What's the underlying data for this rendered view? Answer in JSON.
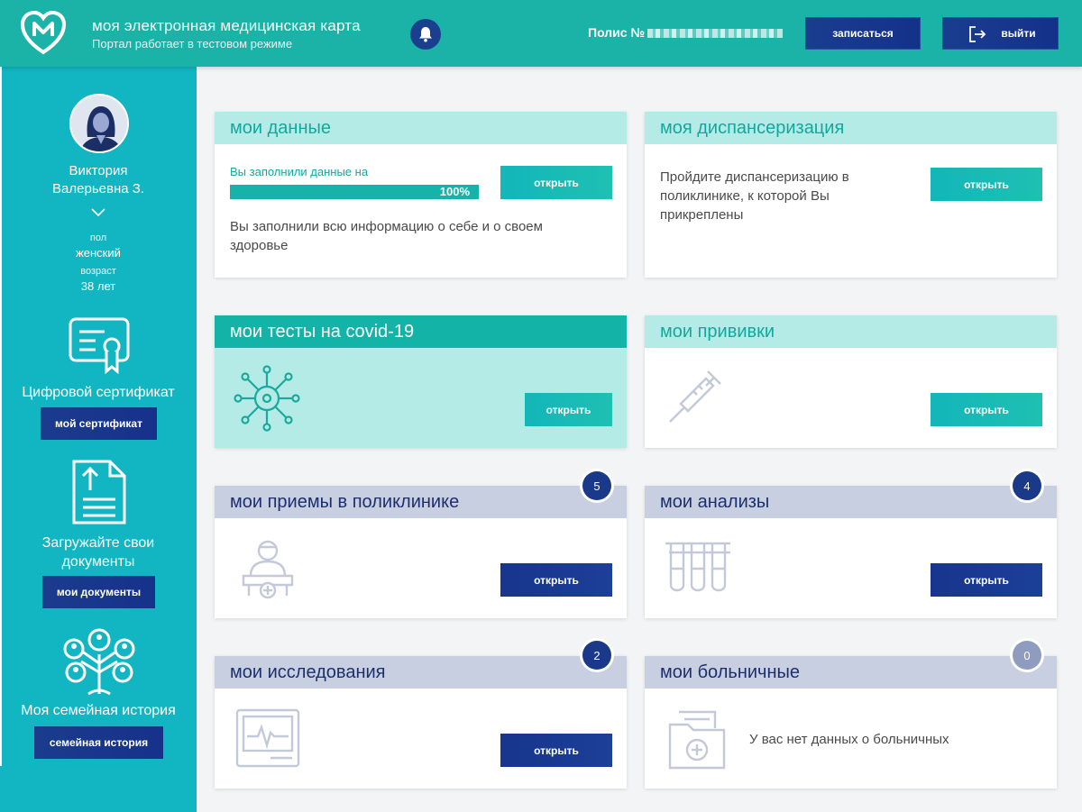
{
  "header": {
    "title": "моя электронная медицинская карта",
    "subtitle": "Портал работает в тестовом режиме",
    "polis_label": "Полис №",
    "book_button": "записаться",
    "exit_button": "выйти",
    "icons": [
      "heart-logo-icon",
      "bell-icon",
      "logout-icon"
    ]
  },
  "sidebar": {
    "user_name": "Виктория Валерьевна З.",
    "gender_label": "пол",
    "gender_value": "женский",
    "age_label": "возраст",
    "age_value": "38 лет",
    "certificate": {
      "title": "Цифровой сертификат",
      "button": "мой сертификат"
    },
    "documents": {
      "title": "Загружайте свои документы",
      "button": "мои документы"
    },
    "family": {
      "title": "Моя семейная история",
      "button": "семейная история"
    }
  },
  "cards": {
    "data": {
      "title": "мои данные",
      "progress_label": "Вы заполнили данные на",
      "progress_value": "100%",
      "progress_fraction": 1.0,
      "text": "Вы заполнили всю информацию о себе и о своем здоровье",
      "button": "открыть"
    },
    "dispensary": {
      "title": "моя диспансеризация",
      "text": "Пройдите диспансеризацию в поликлинике, к которой Вы прикреплены",
      "button": "открыть"
    },
    "covid": {
      "title": "мои тесты на covid-19",
      "button": "открыть"
    },
    "vaccines": {
      "title": "мои прививки",
      "button": "открыть"
    },
    "appointments": {
      "title": "мои приемы в поликлинике",
      "badge": "5",
      "button": "открыть"
    },
    "analyses": {
      "title": "мои анализы",
      "badge": "4",
      "button": "открыть"
    },
    "studies": {
      "title": "мои исследования",
      "badge": "2",
      "button": "открыть"
    },
    "sick_leave": {
      "title": "мои больничные",
      "badge": "0",
      "text": "У вас нет данных о больничных"
    }
  },
  "colors": {
    "header_bg": "#1bb3a8",
    "sidebar_bg": "#12b6c2",
    "navy": "#1a3988",
    "mint": "#b5ebe7",
    "grey_head": "#c8cfe1"
  }
}
